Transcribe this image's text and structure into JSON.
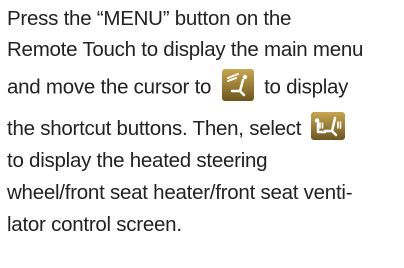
{
  "document": {
    "lines": [
      "Press the “MENU” button on the",
      "Remote Touch to display the main menu",
      "and move the cursor to",
      "to display",
      "the shortcut buttons. Then, select",
      "to display the heated steering",
      "wheel/front seat heater/front seat venti-",
      "lator control screen."
    ],
    "icons": {
      "climate_shortcut": "climate-seat-airflow-icon",
      "seat_heater": "heated-steering-seat-icon"
    },
    "colors": {
      "text": "#222222",
      "icon_bg_light": "#c8a64e",
      "icon_bg_dark": "#6e5520",
      "icon_fg": "#ffffff"
    }
  }
}
